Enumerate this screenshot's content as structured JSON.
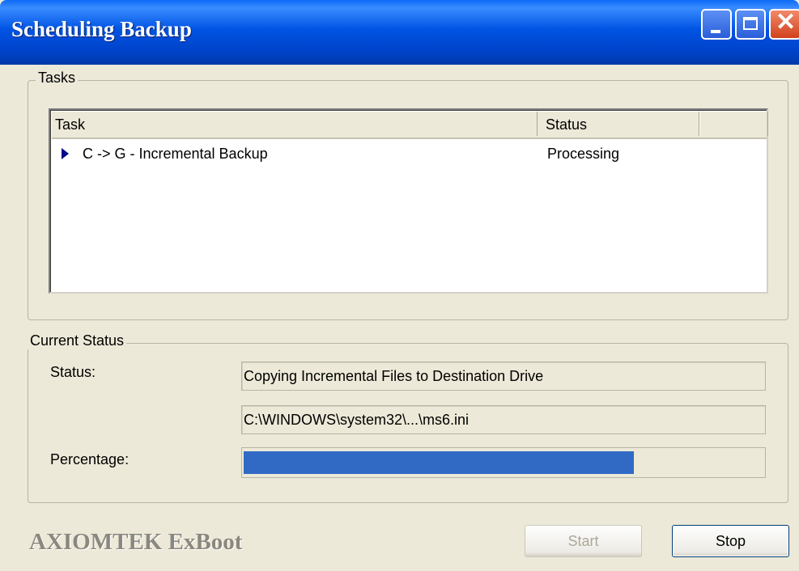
{
  "window": {
    "title": "Scheduling Backup"
  },
  "tasks_group": {
    "legend": "Tasks",
    "columns": [
      "Task",
      "Status",
      ""
    ],
    "rows": [
      {
        "task": "C -> G - Incremental Backup",
        "status": "Processing"
      }
    ]
  },
  "status_group": {
    "legend": "Current Status",
    "status_label": "Status:",
    "status_text": "Copying Incremental Files to Destination Drive",
    "file_path": "C:\\WINDOWS\\system32\\...\\ms6.ini",
    "percentage_label": "Percentage:",
    "progress_fraction": 0.75
  },
  "footer": {
    "brand": "AXIOMTEK ExBoot",
    "start_label": "Start",
    "stop_label": "Stop"
  },
  "colors": {
    "titlebar": "#0054e3",
    "progress_fill": "#316ac5",
    "window_bg": "#ece9d8"
  }
}
